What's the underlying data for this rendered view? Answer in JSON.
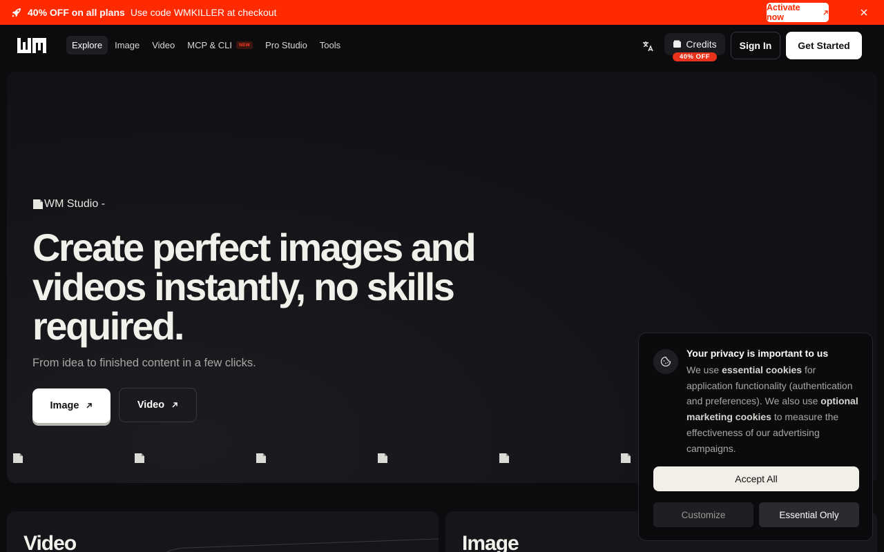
{
  "promo": {
    "headline": "40% OFF on all plans",
    "message": "Use code WMKILLER at checkout",
    "activate_label": "Activate now",
    "icon": "rocket-icon"
  },
  "nav": {
    "logo": "WM",
    "links": [
      {
        "label": "Explore",
        "active": true
      },
      {
        "label": "Image"
      },
      {
        "label": "Video"
      },
      {
        "label": "MCP & CLI",
        "badge": "NEW"
      },
      {
        "label": "Pro Studio"
      },
      {
        "label": "Tools"
      }
    ],
    "credits_label": "Credits",
    "credits_badge": "40% OFF",
    "signin_label": "Sign In",
    "get_started_label": "Get Started"
  },
  "hero": {
    "image_alt": "WM Studio -",
    "headline": "Create perfect images and videos instantly, no skills required.",
    "subline": "From idea to finished content in a few clicks.",
    "image_button": "Image",
    "video_button": "Video"
  },
  "cards": [
    {
      "title": "Video"
    },
    {
      "title": "Image"
    }
  ],
  "cookie": {
    "title": "Your privacy is important to us",
    "body_parts": {
      "p1": "We use ",
      "b1": "essential cookies",
      "p2": " for application functionality (authentication and preferences). We also use ",
      "b2": "optional marketing cookies",
      "p3": " to measure the effectiveness of our advertising campaigns."
    },
    "accept_label": "Accept All",
    "customize_label": "Customize",
    "essential_label": "Essential Only"
  },
  "colors": {
    "promo_bg": "#ff2a00",
    "background": "#0c0c0e",
    "text": "#f2f0ea"
  }
}
